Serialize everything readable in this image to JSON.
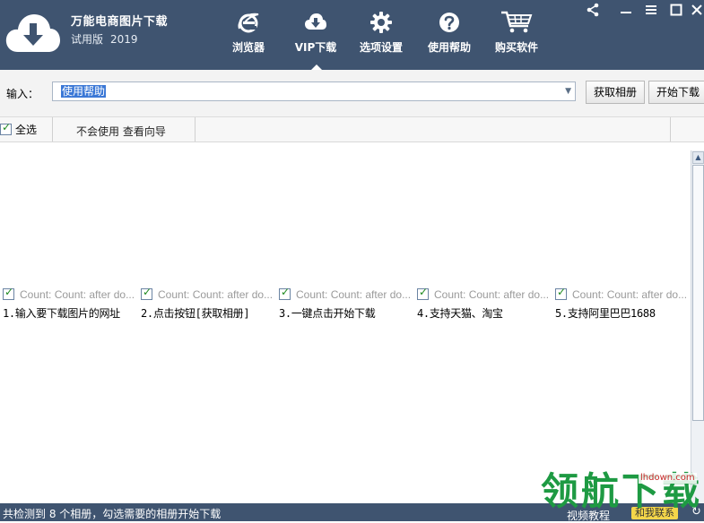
{
  "app": {
    "title": "万能电商图片下载",
    "edition": "试用版",
    "year": "2019"
  },
  "nav": {
    "items": [
      {
        "label": "浏览器",
        "icon": "ie-browser-icon"
      },
      {
        "label": "VIP下载",
        "icon": "cloud-download-icon",
        "active": true
      },
      {
        "label": "选项设置",
        "icon": "gear-icon"
      },
      {
        "label": "使用帮助",
        "icon": "help-icon"
      },
      {
        "label": "购买软件",
        "icon": "shopping-cart-icon"
      }
    ]
  },
  "window": {
    "share": "share-icon",
    "minimize": "minimize-icon",
    "maximize": "maximize-icon",
    "close": "close-icon"
  },
  "input": {
    "label": "输入：",
    "value": "使用帮助"
  },
  "buttons": {
    "fetch": "获取相册",
    "start": "开始下载"
  },
  "toolbar": {
    "select_all": "全选",
    "guide": "不会使用 查看向导"
  },
  "albums": [
    {
      "count": "Count: Count: after do...",
      "title": "1.输入要下载图片的网址",
      "checked": true
    },
    {
      "count": "Count: Count: after do...",
      "title": "2.点击按钮[获取相册]",
      "checked": true
    },
    {
      "count": "Count: Count: after do...",
      "title": "3.一键点击开始下载",
      "checked": true
    },
    {
      "count": "Count: Count: after do...",
      "title": "4.支持天猫、淘宝",
      "checked": true
    },
    {
      "count": "Count: Count: after do...",
      "title": "5.支持阿里巴巴1688",
      "checked": true
    }
  ],
  "status": {
    "text": "共检测到 8 个相册，勾选需要的相册开始下载",
    "video": "视频教程",
    "contact": "和我联系"
  },
  "watermark": {
    "brand": "领航下载",
    "domain": "lhdown.com"
  },
  "colors": {
    "header": "#3f5470",
    "selection": "#3b78d6",
    "check": "#1f8a1f",
    "watermark": "#1e9a43"
  }
}
